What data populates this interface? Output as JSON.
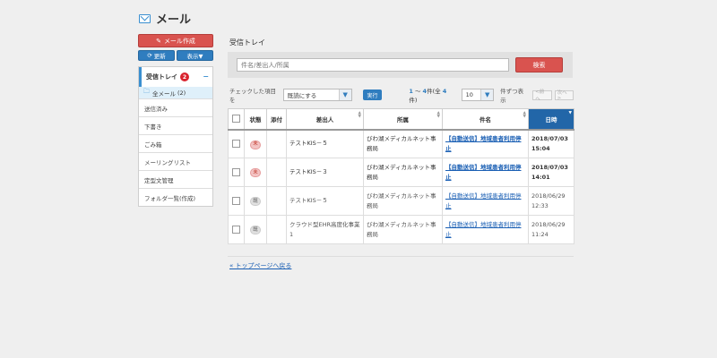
{
  "app": {
    "title": "メール"
  },
  "sidebar": {
    "compose_label": "メール作成",
    "refresh_label": "更新",
    "display_label": "表示▼",
    "inbox": {
      "label": "受信トレイ",
      "badge": "2",
      "collapse": "−"
    },
    "all_mail": {
      "label": "全メール",
      "count": "(2)"
    },
    "folders": [
      "送信済み",
      "下書き",
      "ごみ箱",
      "メーリングリスト",
      "定型文管理",
      "フォルダ一覧(作成)"
    ]
  },
  "main": {
    "section_title": "受信トレイ",
    "search": {
      "placeholder": "件名/差出人/所属",
      "button": "検索"
    },
    "toolbar": {
      "checked_label": "チェックした項目を",
      "action_value": "既読にする",
      "exec_label": "実行",
      "count_start": "1",
      "count_sep": " ～ ",
      "count_end": "4",
      "count_prefix": "件(全 ",
      "count_total": "4",
      "count_suffix": " 件)",
      "per_page_value": "10",
      "per_page_label": "件ずつ表示",
      "prev_label": "<前へ",
      "next_label": "次へ>"
    },
    "table": {
      "headers": {
        "status": "状態",
        "attach": "添付",
        "sender": "差出人",
        "org": "所属",
        "subject": "件名",
        "date": "日時"
      },
      "rows": [
        {
          "status": "未",
          "unread": true,
          "sender": "テストKIS－５",
          "org": "びわ湖メディカルネット事務局",
          "subject": "【自動送信】地域患者利用停止",
          "date": "2018/07/03",
          "time": "15:04"
        },
        {
          "status": "未",
          "unread": true,
          "sender": "テストKIS－３",
          "org": "びわ湖メディカルネット事務局",
          "subject": "【自動送信】地域患者利用停止",
          "date": "2018/07/03",
          "time": "14:01"
        },
        {
          "status": "既",
          "unread": false,
          "sender": "テストKIS－５",
          "org": "びわ湖メディカルネット事務局",
          "subject": "【自動送信】地域患者利用停止",
          "date": "2018/06/29",
          "time": "12:33"
        },
        {
          "status": "既",
          "unread": false,
          "sender": "クラウド型EHR高度化事業1",
          "org": "びわ湖メディカルネット事務局",
          "subject": "【自動送信】地域患者利用停止",
          "date": "2018/06/29",
          "time": "11:24"
        }
      ]
    },
    "back_link": "« トップページへ戻る"
  }
}
